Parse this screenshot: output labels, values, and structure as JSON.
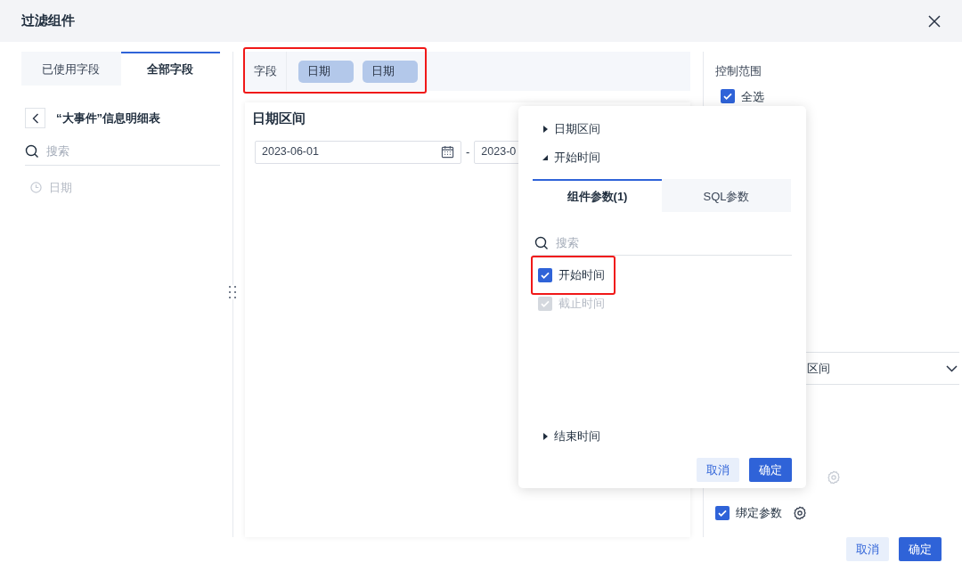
{
  "dialog": {
    "title": "过滤组件"
  },
  "field_panel": {
    "tabs": [
      {
        "label": "已使用字段",
        "selected": false
      },
      {
        "label": "全部字段",
        "selected": true
      }
    ],
    "table_name": "“大事件”信息明细表",
    "search": {
      "placeholder": "搜索"
    },
    "fields": [
      {
        "label": "日期",
        "disabled": true
      }
    ]
  },
  "field_bar": {
    "label": "字段",
    "tags": [
      "日期",
      "日期"
    ],
    "highlighted": true
  },
  "preview": {
    "title": "日期区间",
    "start_date": "2023-06-01",
    "separator": "-",
    "end_date": "2023-0"
  },
  "control": {
    "title": "控制范围",
    "select_all": {
      "label": "全选",
      "checked": true
    },
    "dropdown_value": "区间",
    "bind_params": {
      "label": "绑定参数",
      "checked": true
    }
  },
  "popover": {
    "tree": [
      {
        "label": "日期区间",
        "expanded": false
      },
      {
        "label": "开始时间",
        "expanded": true
      }
    ],
    "tabs": [
      {
        "label": "组件参数(1)",
        "selected": true
      },
      {
        "label": "SQL参数",
        "selected": false
      }
    ],
    "search": {
      "placeholder": "搜索"
    },
    "params": [
      {
        "label": "开始时间",
        "checked": true,
        "disabled": false,
        "highlighted": true
      },
      {
        "label": "截止时间",
        "checked": true,
        "disabled": true,
        "highlighted": false
      }
    ],
    "after": [
      {
        "label": "结束时间",
        "expanded": false
      }
    ],
    "buttons": [
      {
        "label": "取消",
        "kind": "secondary"
      },
      {
        "label": "确定",
        "kind": "primary"
      }
    ]
  },
  "footer_buttons": [
    {
      "label": "取消",
      "kind": "secondary"
    },
    {
      "label": "确定",
      "kind": "primary"
    }
  ]
}
